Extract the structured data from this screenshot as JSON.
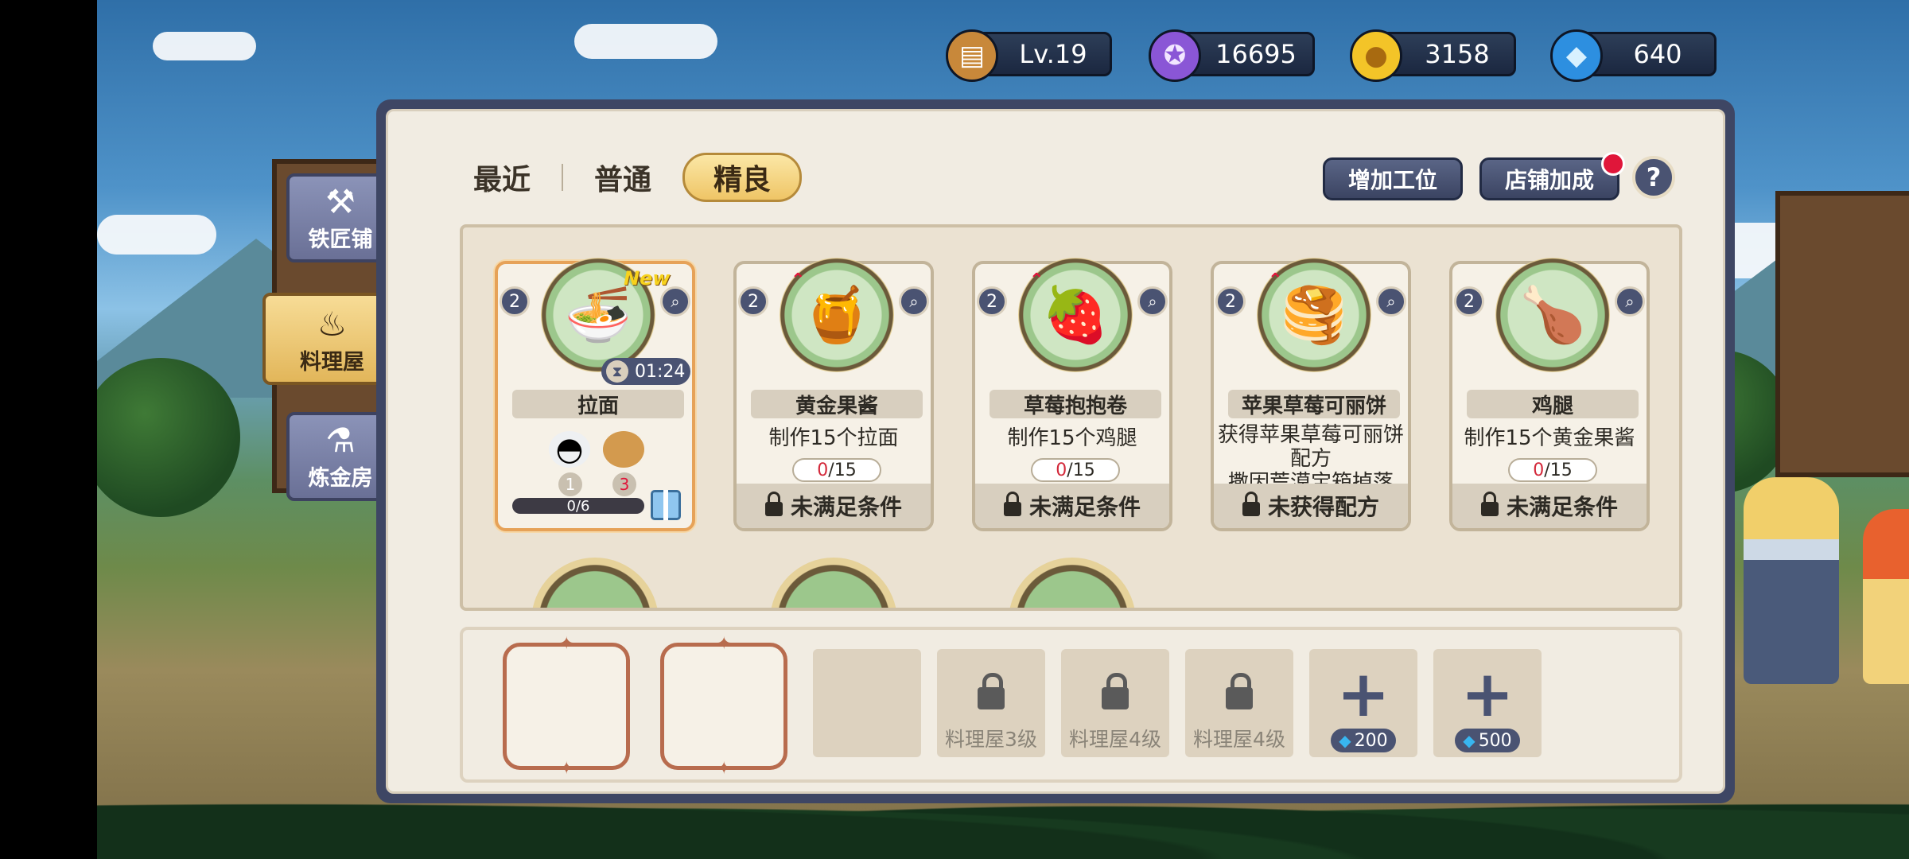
{
  "currency": {
    "level": "Lv.19",
    "medal": "16695",
    "gold": "3158",
    "diamond": "640",
    "icons": [
      "chest-icon",
      "purple-medal-icon",
      "gold-coin-icon",
      "diamond-plus-icon"
    ]
  },
  "side_tabs": [
    {
      "label": "铁匠铺",
      "icon": "anvil-icon",
      "active": false
    },
    {
      "label": "料理屋",
      "icon": "cooking-pot-icon",
      "active": true
    },
    {
      "label": "炼金房",
      "icon": "flask-icon",
      "active": false
    }
  ],
  "segments": [
    "最近",
    "普通",
    "精良"
  ],
  "selected_segment": "精良",
  "buttons": {
    "add_workstation": "增加工位",
    "shop_bonus": "店铺加成",
    "help": "?"
  },
  "recipes": [
    {
      "name": "拉面",
      "level": "2",
      "is_new": true,
      "new_label": "New",
      "timer": "01:24",
      "ingredients": [
        {
          "icon": "rice-ball-icon",
          "count": "1"
        },
        {
          "icon": "egg-icon",
          "count": "3"
        }
      ],
      "batch": "0/6"
    },
    {
      "name": "黄金果酱",
      "level": "2",
      "desc": "制作15个拉面",
      "progress_current": "0",
      "progress_total": "/15",
      "status": "未满足条件"
    },
    {
      "name": "草莓抱抱卷",
      "level": "2",
      "desc": "制作15个鸡腿",
      "progress_current": "0",
      "progress_total": "/15",
      "status": "未满足条件"
    },
    {
      "name": "苹果草莓可丽饼",
      "level": "2",
      "desc_line1": "获得苹果草莓可丽饼",
      "desc_line2": "配方",
      "desc_line3": "撒因荒漠宝箱掉落",
      "status": "未获得配方"
    },
    {
      "name": "鸡腿",
      "level": "2",
      "desc": "制作15个黄金果酱",
      "progress_current": "0",
      "progress_total": "/15",
      "status": "未满足条件"
    }
  ],
  "slots": [
    {
      "type": "empty"
    },
    {
      "type": "empty"
    },
    {
      "type": "blank"
    },
    {
      "type": "locked",
      "label": "料理屋3级"
    },
    {
      "type": "locked",
      "label": "料理屋4级"
    },
    {
      "type": "locked",
      "label": "料理屋4级"
    },
    {
      "type": "buy",
      "price": "200"
    },
    {
      "type": "buy",
      "price": "500"
    }
  ]
}
